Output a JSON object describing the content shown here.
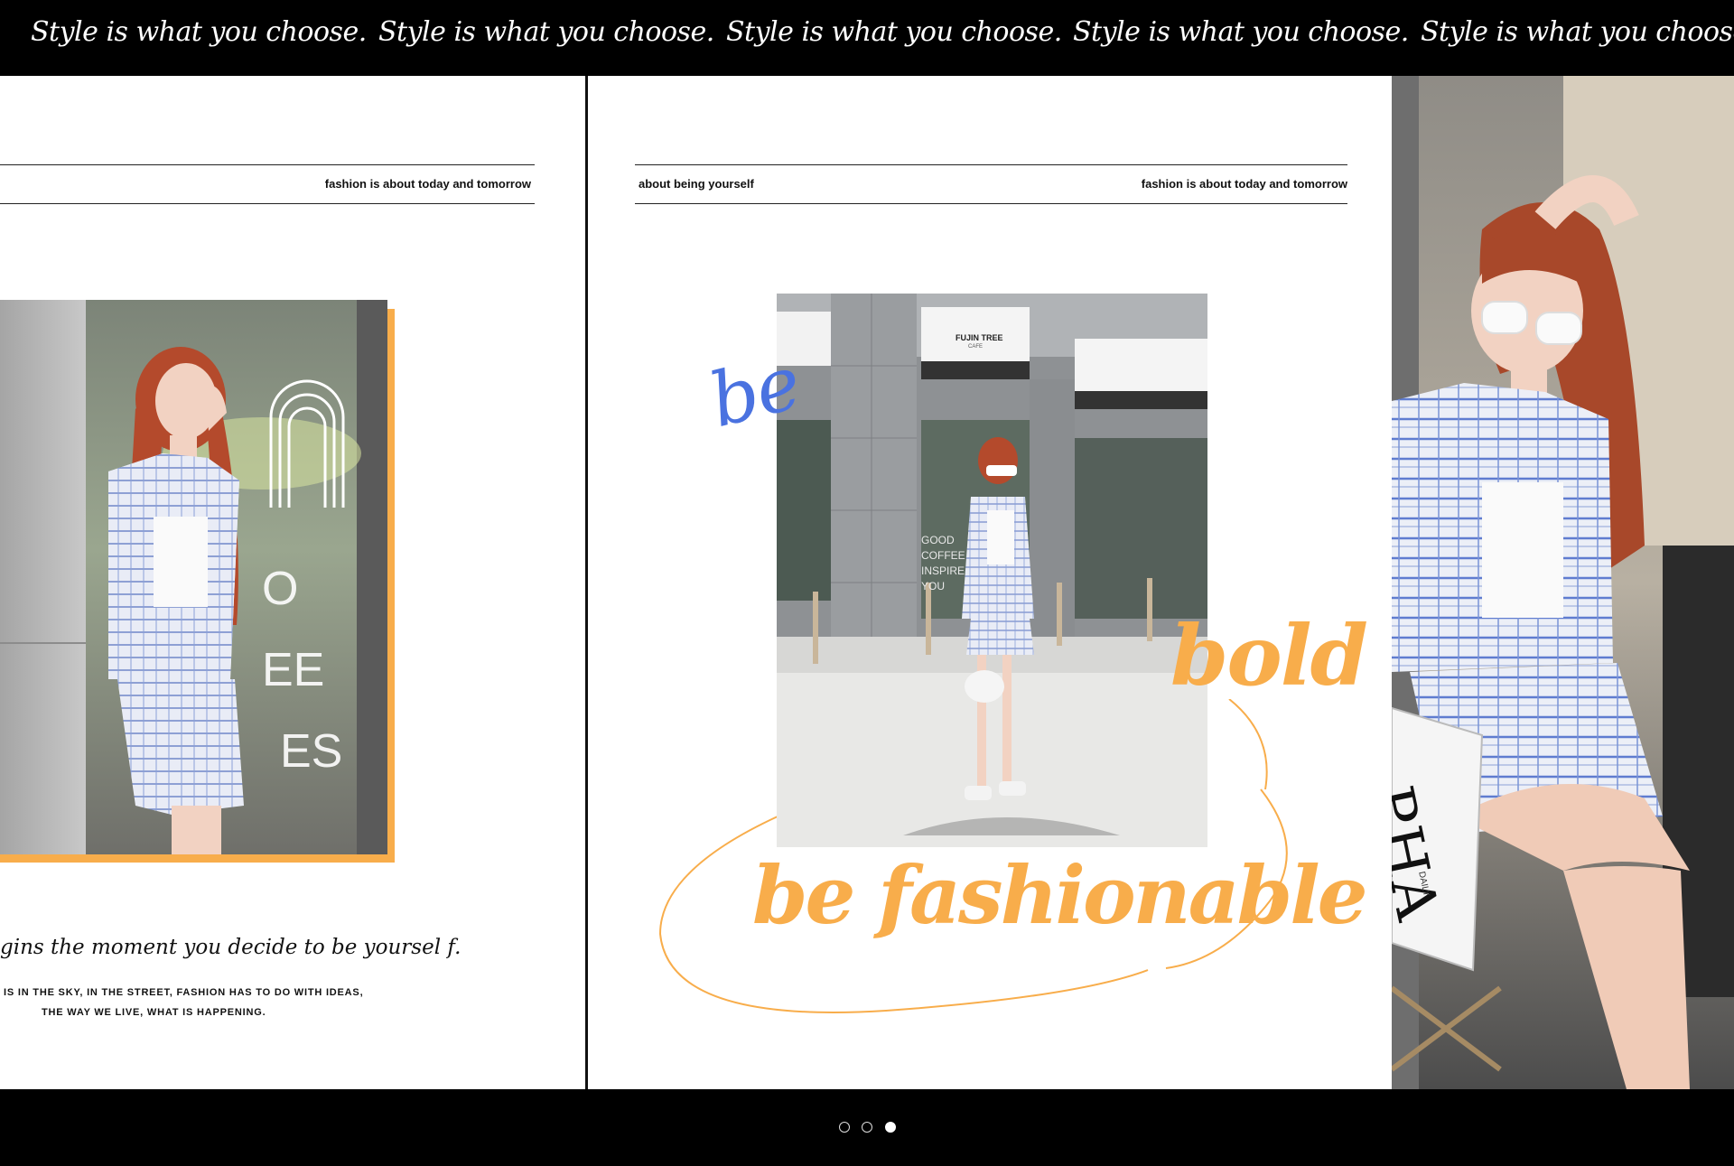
{
  "marquee": {
    "items": [
      "Style is what you choose.",
      "Style is what you choose.",
      "Style is what you choose.",
      "Style is what you choose.",
      "Style is what you choose."
    ]
  },
  "left_panel": {
    "header_right": "fashion is about today and tomorrow",
    "quote": "gins the moment you decide to be yoursel f.",
    "caps_line1": "IS IN THE SKY, IN THE STREET, FASHION HAS TO DO WITH IDEAS,",
    "caps_line2": "THE WAY WE LIVE, WHAT IS HAPPENING.",
    "photo_sign_letters": [
      "O",
      "EE",
      "ES"
    ]
  },
  "mid_panel": {
    "header_left": "about being yourself",
    "header_right": "fashion is about today and tomorrow",
    "word_be": "be",
    "word_bold": "bold",
    "word_fashionable": "be fashionable",
    "storefront_sign": "FUJIN TREE",
    "storefront_sub": "CAFE",
    "window_text": [
      "GOOD",
      "COFFEE",
      "INSPIRE",
      "YOU"
    ]
  },
  "right_panel": {
    "magazine_letters": "PHA",
    "magazine_small": "DAILY"
  },
  "pagination": {
    "count": 3,
    "active_index": 2
  },
  "colors": {
    "accent_orange": "#f8ad4b",
    "accent_blue": "#4a72e0",
    "background_dark": "#000000"
  }
}
